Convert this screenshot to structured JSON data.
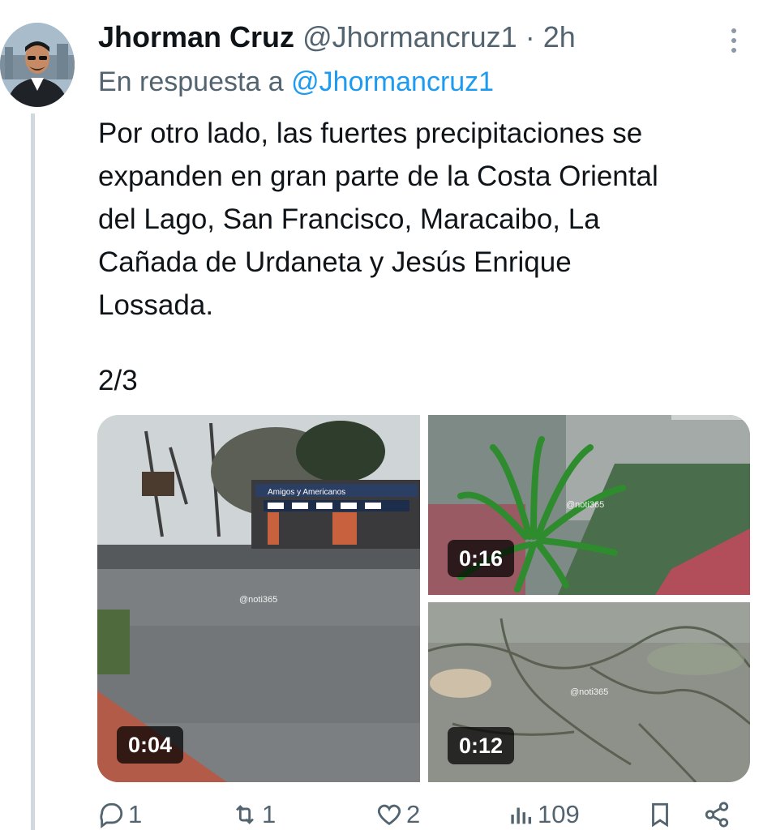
{
  "tweet": {
    "display_name": "Jhorman Cruz",
    "handle": "@Jhormancruz1",
    "separator": "·",
    "time": "2h",
    "reply_prefix": "En respuesta a",
    "reply_to": "@Jhormancruz1",
    "text": "Por otro lado, las fuertes precipitaciones se\nexpanden en gran parte de la Costa Oriental\ndel Lago, San Francisco, Maracaibo, La\nCañada de Urdaneta y Jesús Enrique\nLossada.",
    "counter": "2/3"
  },
  "media": [
    {
      "duration": "0:04",
      "watermark": "@noti365",
      "overlay_text": "Amigos y Americanos"
    },
    {
      "duration": "0:16",
      "watermark": "@noti365"
    },
    {
      "duration": "0:12",
      "watermark": "@noti365"
    }
  ],
  "actions": {
    "replies": "1",
    "reposts": "1",
    "likes": "2",
    "views": "109"
  },
  "icons": [
    "more-options-icon",
    "reply-icon",
    "repost-icon",
    "like-icon",
    "views-icon",
    "bookmark-icon",
    "share-icon"
  ],
  "colors": {
    "link": "#1d9bf0",
    "muted": "#536471",
    "text": "#0f1419"
  }
}
